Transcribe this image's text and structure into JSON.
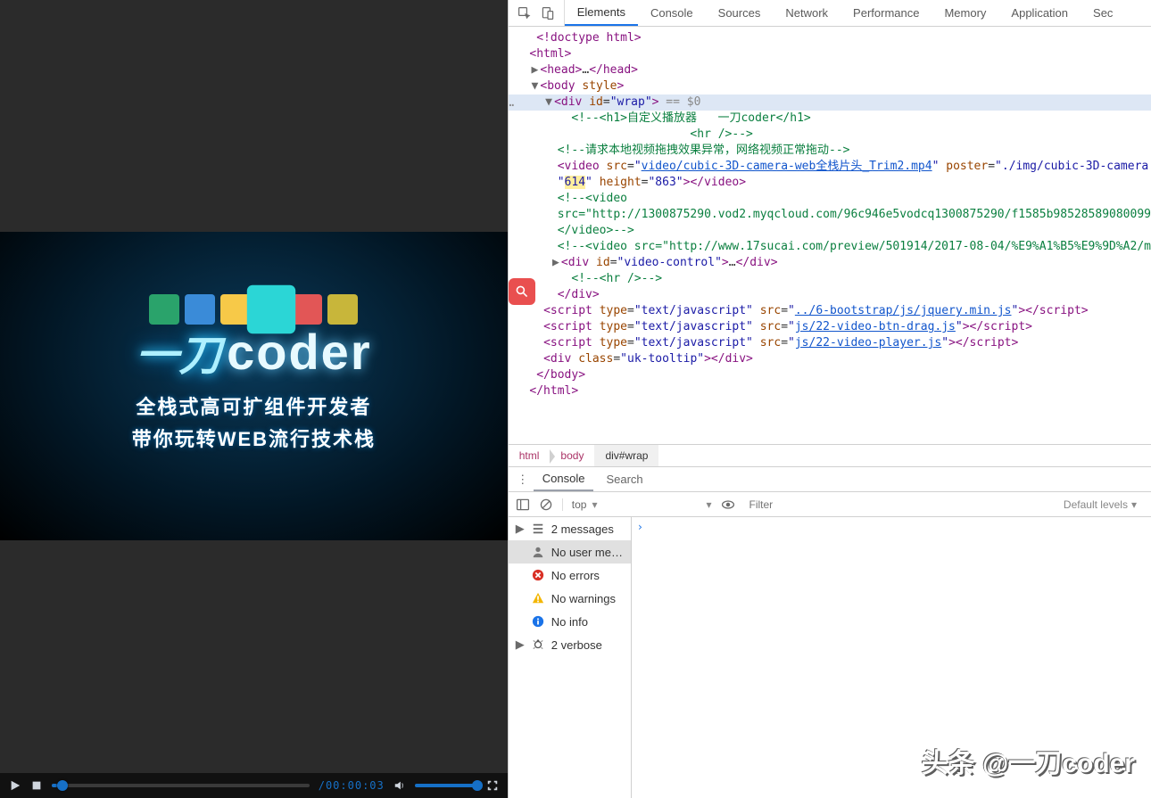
{
  "video": {
    "poster": {
      "brand_cn": "一刀",
      "brand_en": "coder",
      "subtitle1": "全栈式高可扩组件开发者",
      "subtitle2": "带你玩转WEB流行技术栈"
    },
    "controls": {
      "current_time": "",
      "duration": "/00:00:03"
    }
  },
  "devtools": {
    "tabs": [
      "Elements",
      "Console",
      "Sources",
      "Network",
      "Performance",
      "Memory",
      "Application",
      "Sec"
    ],
    "active_tab": "Elements",
    "dom": {
      "doctype": "<!doctype html>",
      "html_open": "<html>",
      "head": "<head>…</head>",
      "body_open": "<body style>",
      "wrap_open_pre": "<div id=\"",
      "wrap_id": "wrap",
      "wrap_open_post": "\">",
      "wrap_suffix": " == $0",
      "cmt_h1": "<!--<h1>自定义播放器   一刀coder</h1>",
      "cmt_hr1": "<hr />-->",
      "cmt_drag": "<!--请求本地视频拖拽效果异常，网络视频正常拖动-->",
      "video_tag": {
        "open": "<video src=\"",
        "src": "video/cubic-3D-camera-web全栈片头_Trim2.mp4",
        "mid": "\" poster=\"./img/cubic-3D-camera",
        "w_attr": "\"614\"",
        "h_attr": " height=\"863\"></video>"
      },
      "cmt_video1a": "<!--<video",
      "cmt_video1b": "src=\"http://1300875290.vod2.myqcloud.com/96c946e5vodcq1300875290/f1585b98528589080099",
      "cmt_video1c": "</video>-->",
      "cmt_video2": "<!--<video src=\"http://www.17sucai.com/preview/501914/2017-08-04/%E9%A1%B5%E9%9D%A2/m",
      "video_control": "<div id=\"video-control\">…</div>",
      "cmt_hr2": "<!--<hr />-->",
      "wrap_close": "</div>",
      "script1_pre": "<script type=\"text/javascript\" src=\"",
      "script1_src": "../6-bootstrap/js/jquery.min.js",
      "script2_src": "js/22-video-btn-drag.js",
      "script3_src": "js/22-video-player.js",
      "script_post": "\"></script>",
      "tooltip": "<div class=\"uk-tooltip\"></div>",
      "body_close": "</body>",
      "html_close": "</html>"
    },
    "breadcrumb": [
      "html",
      "body",
      "div#wrap"
    ],
    "drawer": {
      "tabs": [
        "Console",
        "Search"
      ],
      "active": "Console",
      "context": "top",
      "filter_placeholder": "Filter",
      "levels": "Default levels",
      "sidebar": [
        {
          "icon": "list",
          "label": "2 messages",
          "expandable": true
        },
        {
          "icon": "user",
          "label": "No user me…",
          "selected": true
        },
        {
          "icon": "error",
          "label": "No errors"
        },
        {
          "icon": "warn",
          "label": "No warnings"
        },
        {
          "icon": "info",
          "label": "No info"
        },
        {
          "icon": "bug",
          "label": "2 verbose",
          "expandable": true
        }
      ],
      "prompt": "›"
    }
  },
  "watermark": "头条 @一刀coder"
}
